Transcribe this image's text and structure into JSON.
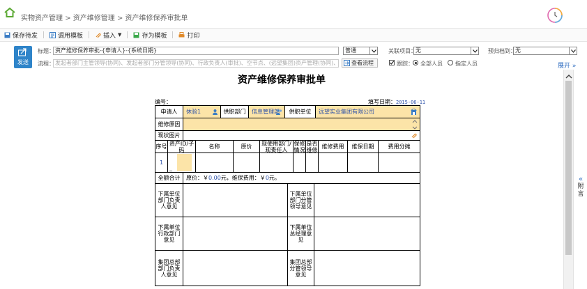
{
  "breadcrumb": {
    "item1": "实物资产管理",
    "sep": ">",
    "item2": "资产维修管理",
    "item3": "资产维修保养审批单"
  },
  "toolbar": {
    "save_draft": "保存待发",
    "load_template": "调用模板",
    "insert": "插入",
    "save_as_template": "存为模板",
    "print": "打印"
  },
  "form_header": {
    "send_label": "发送",
    "title_label": "标题：",
    "title_value": "资产维修保养审批-{申请人}-{系统日期}",
    "priority_value": "普通",
    "related_project_label": "关联项目：",
    "related_project_value": "无",
    "archive_label": "预归档到：",
    "archive_value": "无",
    "flow_label": "流程：",
    "flow_placeholder": "发起者部门主管领导(协同)、发起者部门分管领导(协同)、行政负责人(审批)、空节点、(远望集团)资产管理(协同)、行政负责人(知会)...",
    "view_flow": "查看流程",
    "trace_label": "跟踪：",
    "radio_all": "全部人员",
    "radio_specified": "指定人员",
    "expand": "展开"
  },
  "document": {
    "title": "资产维修保养审批单",
    "number_label": "编号：",
    "fill_date_label": "填写日期：",
    "fill_date_value": "2015-06-11",
    "applicant_label": "申请人",
    "applicant_value": "休验1",
    "dept_label": "供职部门",
    "dept_value": "信息管理部",
    "unit_label": "供职单位",
    "unit_value": "远望实业集团有限公司",
    "reason_label": "维修原因",
    "photo_label": "现状图片",
    "columns": [
      "序号",
      "资产ID/子码",
      "名称",
      "原价",
      "现使用部门/现责任人",
      "保修情况",
      "是否维修",
      "维修费用",
      "维保日期",
      "费用分摊"
    ],
    "row_index": "1",
    "row_sub": "_",
    "total_label": "全额合计",
    "total_text_a": "原价：￥",
    "total_price": "0.00",
    "total_text_b": "元，维保费用：￥",
    "total_fee": "0",
    "total_text_c": "元。",
    "opinion1_left": "下属单位部门负责人意见",
    "opinion1_right": "下属单位部门分管领导意见",
    "opinion2_left": "下属单位行政部门意见",
    "opinion2_right": "下属单位总经理意见",
    "opinion3_left": "集团总部部门负责人意见",
    "opinion3_right": "集团总部分管领导意见"
  },
  "sidebar": {
    "label": "附言"
  },
  "colors": {
    "accent": "#2e84c9",
    "fill_yellow": "#fce4a8",
    "link_blue": "#2a4fa8"
  }
}
